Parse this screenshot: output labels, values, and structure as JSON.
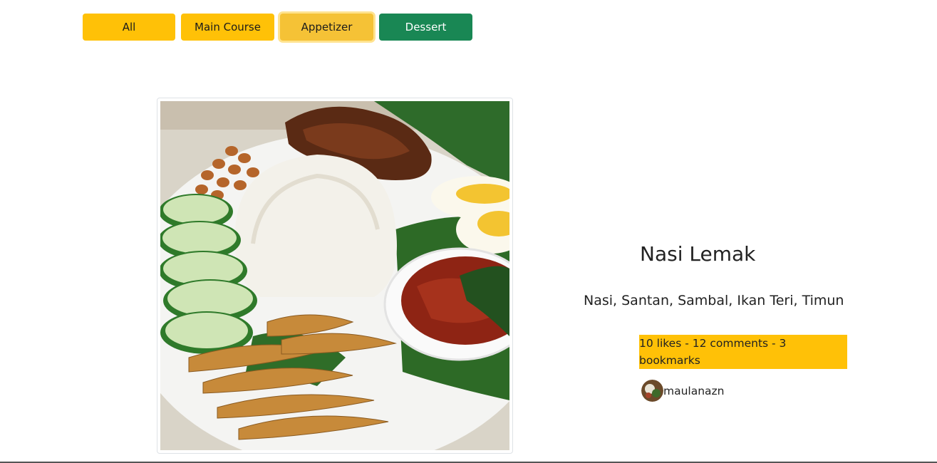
{
  "filters": [
    {
      "label": "All"
    },
    {
      "label": "Main Course"
    },
    {
      "label": "Appetizer"
    },
    {
      "label": "Dessert"
    }
  ],
  "recipe": {
    "title": "Nasi Lemak",
    "ingredients": "Nasi, Santan, Sambal, Ikan Teri, Timun",
    "stats": "10 likes - 12 comments - 3 bookmarks",
    "author": "maulanazn"
  },
  "colors": {
    "accent_yellow": "#ffc107",
    "accent_green": "#198754"
  },
  "icons": {
    "photo": "nasi-lemak-photo",
    "avatar": "user-avatar"
  }
}
